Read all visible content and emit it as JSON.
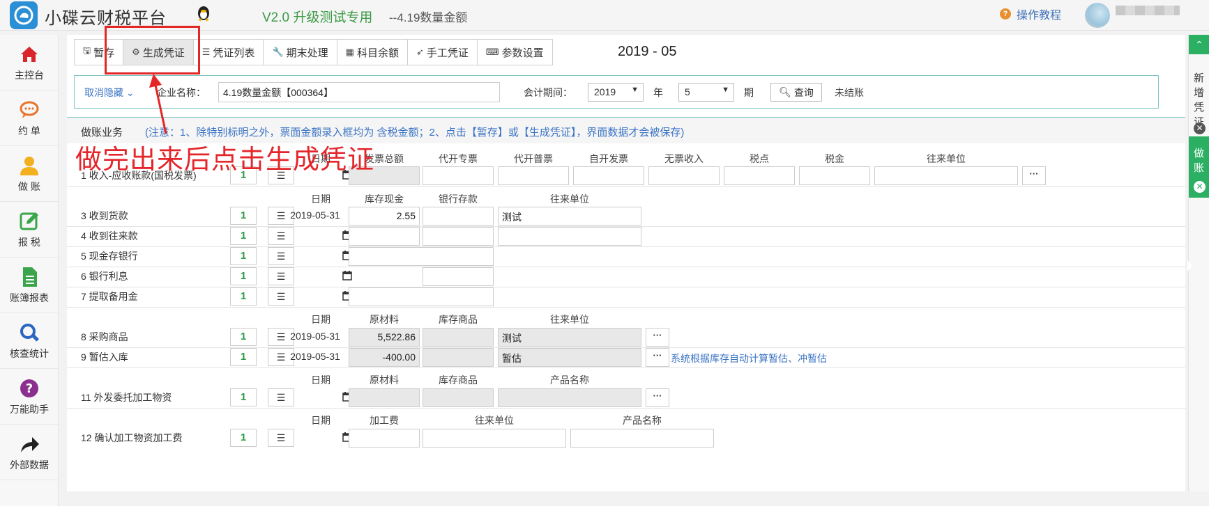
{
  "topbar": {
    "app_title": "小碟云财税平台",
    "version": "V2.0 升级测试专用",
    "version_sub": "--4.19数量金额",
    "help_label": "操作教程"
  },
  "sidebar": {
    "items": [
      {
        "label": "主控台",
        "icon": "home-icon"
      },
      {
        "label": "约 单",
        "icon": "chat-icon"
      },
      {
        "label": "做 账",
        "icon": "user-icon"
      },
      {
        "label": "报 税",
        "icon": "edit-icon"
      },
      {
        "label": "账簿报表",
        "icon": "document-icon"
      },
      {
        "label": "核查统计",
        "icon": "search-icon"
      },
      {
        "label": "万能助手",
        "icon": "help-icon"
      },
      {
        "label": "外部数据",
        "icon": "share-icon"
      }
    ]
  },
  "toolbar": {
    "save": "暂存",
    "generate": "生成凭证",
    "voucher_list": "凭证列表",
    "period_end": "期末处理",
    "subject_balance": "科目余额",
    "manual_voucher": "手工凭证",
    "settings": "参数设置",
    "period": "2019 - 05"
  },
  "filter": {
    "hide_link": "取消隐藏",
    "company_label": "企业名称：",
    "company_value": "4.19数量金额【000364】",
    "period_label": "会计期间：",
    "year": "2019",
    "year_unit": "年",
    "month": "5",
    "month_unit": "期",
    "query": "查询",
    "status": "未结账"
  },
  "biz": {
    "title": "做账业务",
    "note": "(注意：1、除特别标明之外，票面金额录入框均为 含税金额；2、点击【暂存】或【生成凭证】，界面数据才会被保存)"
  },
  "annotation": "做完出来后点击生成凭证",
  "headers": {
    "h1": [
      "日期",
      "发票总额",
      "代开专票",
      "代开普票",
      "自开发票",
      "无票收入",
      "税点",
      "税金",
      "往来单位"
    ],
    "h2": [
      "日期",
      "库存现金",
      "银行存款",
      "往来单位"
    ],
    "h3": [
      "日期",
      "原材料",
      "库存商品",
      "往来单位"
    ],
    "h4": [
      "日期",
      "原材料",
      "库存商品",
      "产品名称"
    ],
    "h5": [
      "日期",
      "加工费",
      "往来单位",
      "产品名称"
    ]
  },
  "rows": {
    "r1": {
      "name": "1  收入-应收账款(国税发票)",
      "count": "1"
    },
    "r3": {
      "name": "3  收到货款",
      "count": "1",
      "date": "2019-05-31",
      "cash": "2.55",
      "partner": "测试"
    },
    "r4": {
      "name": "4  收到往来款",
      "count": "1"
    },
    "r5": {
      "name": "5  现金存银行",
      "count": "1"
    },
    "r6": {
      "name": "6  银行利息",
      "count": "1"
    },
    "r7": {
      "name": "7  提取备用金",
      "count": "1"
    },
    "r8": {
      "name": "8  采购商品",
      "count": "1",
      "date": "2019-05-31",
      "material": "5,522.86",
      "partner": "测试"
    },
    "r9": {
      "name": "9  暂估入库",
      "count": "1",
      "date": "2019-05-31",
      "material": "-400.00",
      "partner": "暂估",
      "hint": "系统根据库存自动计算暂估、冲暂估"
    },
    "r11": {
      "name": "11  外发委托加工物资",
      "count": "1"
    },
    "r12": {
      "name": "12  确认加工物资加工费",
      "count": "1"
    }
  },
  "rail": {
    "new_voucher": "新增凭证",
    "accounting": "做账"
  },
  "colors": {
    "accent_green": "#2bb063",
    "link_blue": "#3a73c4",
    "annotation_red": "#e4262b"
  }
}
